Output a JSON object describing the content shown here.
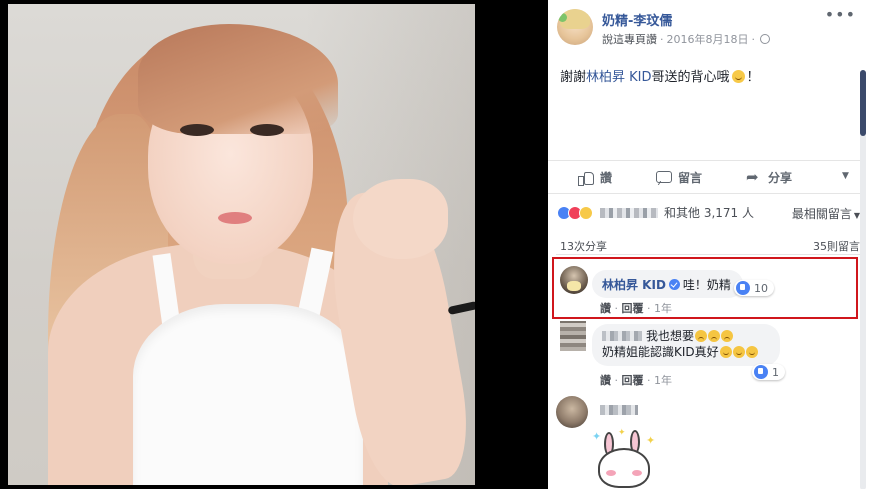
{
  "post": {
    "page_name": "奶精-李玟儒",
    "meta_like_link": "說這專頁讚",
    "meta_sep": "·",
    "meta_date": "2016年8月18日",
    "meta_sep2": "·",
    "more_icon": "•••",
    "caption_prefix": "謝謝",
    "caption_mention": "林柏昇 KID",
    "caption_suffix": "哥送的背心哦",
    "caption_end": "！"
  },
  "actions": {
    "like": "讚",
    "comment": "留言",
    "share": "分享",
    "menu_icon": "▼"
  },
  "reactions": {
    "summary": "和其他 3,171 人",
    "sort_label": "最相關留言",
    "sort_caret": "▼"
  },
  "counts": {
    "shares": "13次分享",
    "comments": "35則留言"
  },
  "comments": [
    {
      "author": "林柏昇 KID",
      "text": "哇！奶精",
      "likes": "10",
      "like_action": "讚",
      "reply_action": "回覆",
      "time": "1年",
      "sep": "·"
    },
    {
      "line1": "我也想要",
      "line2": "奶精姐能認識KID真好",
      "likes": "1",
      "like_action": "讚",
      "reply_action": "回覆",
      "time": "1年",
      "sep": "·"
    }
  ],
  "colors": {
    "link_blue": "#365899",
    "highlight_red": "#d0161c",
    "like_blue": "#4a82f4"
  },
  "icons": [
    "globe-icon",
    "thumbs-up-icon",
    "comment-bubble-icon",
    "share-arrow-icon",
    "verified-icon",
    "like-reaction-icon",
    "love-reaction-icon",
    "wow-reaction-icon"
  ]
}
